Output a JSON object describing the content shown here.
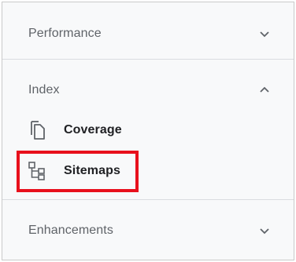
{
  "sections": [
    {
      "label": "Performance",
      "state": "collapsed",
      "chevron_icon": "chevron-down-icon"
    },
    {
      "label": "Index",
      "state": "expanded",
      "chevron_icon": "chevron-up-icon",
      "items": [
        {
          "label": "Coverage",
          "icon": "copy-pages-icon"
        },
        {
          "label": "Sitemaps",
          "icon": "sitemap-tree-icon",
          "highlighted": true
        }
      ]
    },
    {
      "label": "Enhancements",
      "state": "collapsed",
      "chevron_icon": "chevron-down-icon"
    }
  ],
  "colors": {
    "background": "#f8f9fa",
    "section_label": "#5f6368",
    "item_label": "#202124",
    "divider": "#dadce0",
    "highlight_border": "#e8101c"
  }
}
